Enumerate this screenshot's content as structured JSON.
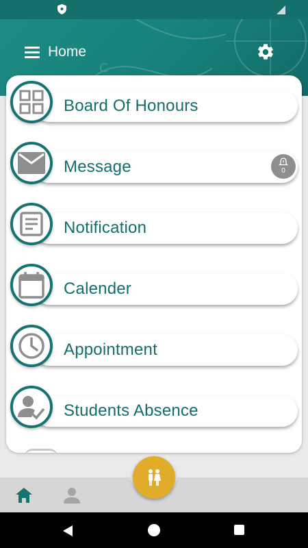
{
  "app": {
    "title": "Home",
    "icons": {
      "menu": "menu-icon",
      "settings": "gear-icon",
      "status_left": "shield-icon",
      "status_right": "signal-icon"
    }
  },
  "menu": {
    "items": [
      {
        "label": "Board Of Honours",
        "icon": "grid-icon"
      },
      {
        "label": "Message",
        "icon": "envelope-icon",
        "badge_icon": "bell-icon",
        "badge_count": "0"
      },
      {
        "label": "Notification",
        "icon": "document-icon"
      },
      {
        "label": "Calender",
        "icon": "calendar-icon"
      },
      {
        "label": "Appointment",
        "icon": "clock-icon"
      },
      {
        "label": "Students Absence",
        "icon": "user-check-icon"
      }
    ]
  },
  "bottom_nav": {
    "items": [
      {
        "name": "home",
        "icon": "home-icon",
        "active": true
      },
      {
        "name": "profile",
        "icon": "person-icon",
        "active": false
      }
    ],
    "fab_icon": "family-icon"
  },
  "colors": {
    "primary": "#157370",
    "header": "#1a857e",
    "text": "#136e6b",
    "accent": "#e1ac2a",
    "icon_gray": "#8e8e8e"
  }
}
